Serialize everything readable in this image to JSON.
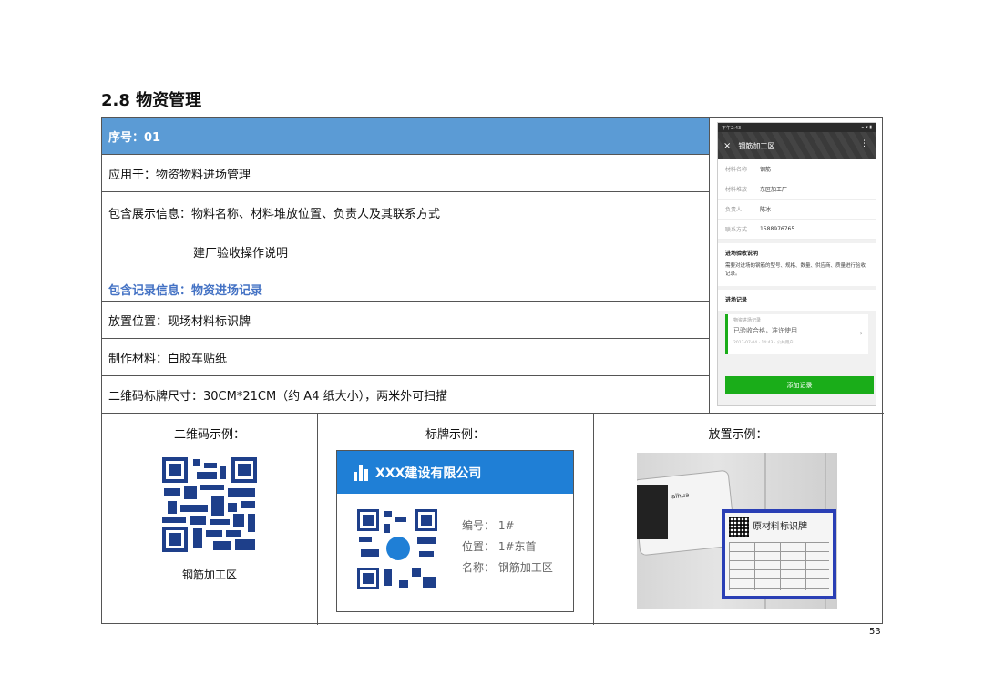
{
  "section_title": "2.8 物资管理",
  "rows": {
    "serial": "序号：01",
    "applied_to": "应用于：物资物料进场管理",
    "display_info": "包含展示信息：物料名称、材料堆放位置、负责人及其联系方式",
    "display_info_extra": "建厂验收操作说明",
    "record_info": "包含记录信息：物资进场记录",
    "placement": "放置位置：现场材料标识牌",
    "material": "制作材料：白胶车贴纸",
    "size": "二维码标牌尺寸：30CM*21CM（约 A4 纸大小），两米外可扫描"
  },
  "phone": {
    "status_time": "下午2:43",
    "status_icons": "⌁ ▾ ▮",
    "close_icon": "×",
    "title": "钢筋加工区",
    "menu_icon": "⋮",
    "fields": [
      {
        "k": "材料名称",
        "v": "钢筋"
      },
      {
        "k": "材料堆放",
        "v": "东区加工厂"
      },
      {
        "k": "负责人",
        "v": "陈冰"
      },
      {
        "k": "联系方式",
        "v": "1588976765"
      }
    ],
    "accept_heading": "进场验收说明",
    "accept_text": "需要对进场的钢筋的型号、规格、数量、供应商、质量进行验收记录。",
    "record_heading": "进场记录",
    "record": {
      "label": "物资进场记录",
      "status": "已验收合格，准许使用",
      "meta": "2017-07-04 · 14:43 · 公共用户",
      "chevron": "›"
    },
    "add_button": "添加记录"
  },
  "bottom": {
    "qr_title": "二维码示例：",
    "sign_title": "标牌示例：",
    "place_title": "放置示例：",
    "qr_caption": "钢筋加工区"
  },
  "sign": {
    "company": "XXX建设有限公司",
    "number": "编号： 1#",
    "position": "位置： 1#东首",
    "name": "名称： 钢筋加工区"
  },
  "photo": {
    "camera_brand": "alhua",
    "plate_title": "原材料标识牌"
  },
  "page_number": "53",
  "colors": {
    "header_blue": "#5b9bd5",
    "accent_blue": "#4472c4",
    "qr_blue": "#1e3f8a",
    "sign_blue": "#1f7fd6",
    "wechat_green": "#1aad19"
  }
}
